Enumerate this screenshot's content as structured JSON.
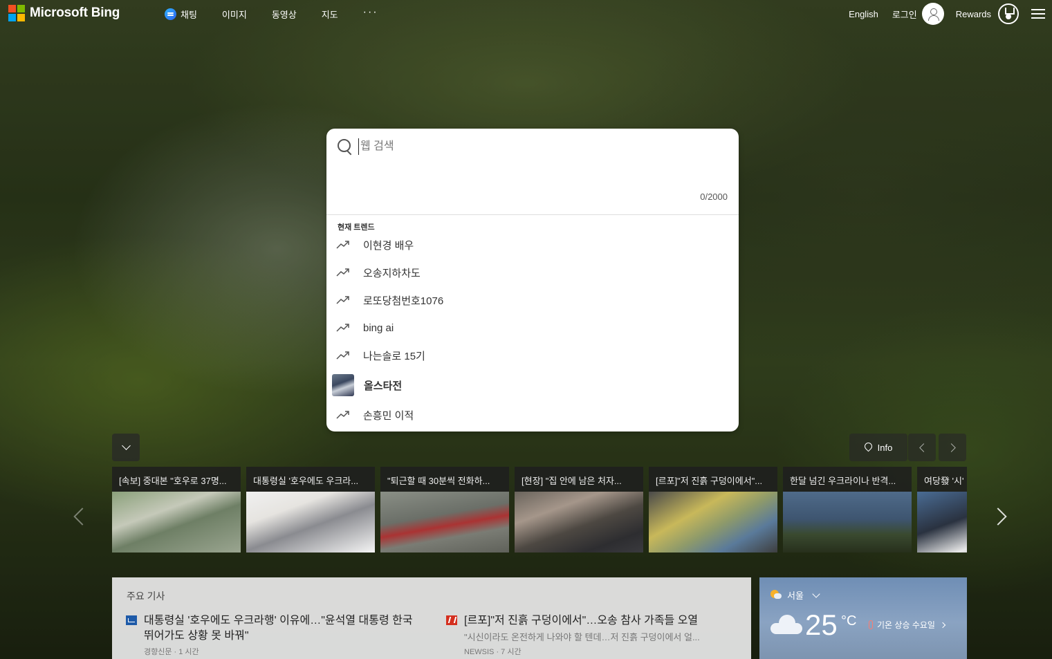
{
  "header": {
    "logo_text": "Microsoft Bing",
    "nav": [
      {
        "label": "채팅",
        "icon": "chat-icon"
      },
      {
        "label": "이미지"
      },
      {
        "label": "동영상"
      },
      {
        "label": "지도"
      },
      {
        "label": "···"
      }
    ],
    "language": "English",
    "login": "로그인",
    "rewards": "Rewards"
  },
  "search": {
    "placeholder": "웹 검색",
    "char_count": "0/2000",
    "trends_heading": "현재 트렌드",
    "trends": [
      "이현경 배우",
      "오송지하차도",
      "로또당첨번호1076",
      "bing ai",
      "나는솔로 15기",
      "올스타전",
      "손흥민 이적"
    ]
  },
  "carousel": {
    "info_label": "Info",
    "cards": [
      "[속보] 중대본 \"호우로 37명...",
      "대통령실 '호우에도 우크라...",
      "\"퇴근할 때 30분씩 전화하...",
      "[현장] \"집 안에 남은 처자...",
      "[르포]\"저 진흙 구덩이에서\"...",
      "한달 넘긴 우크라이나 반격...",
      "여당發 '시'"
    ]
  },
  "news": {
    "heading": "주요 기사",
    "items": [
      {
        "title": "대통령실 '호우에도 우크라행' 이유에…\"윤석열 대통령 한국 뛰어가도 상황 못 바꿔\"",
        "snippet": "",
        "source": "경향신문 · 1 시간"
      },
      {
        "title": "[르포]\"저 진흙 구덩이에서\"…오송 참사 가족들 오열",
        "snippet": "\"시신이라도 온전하게 나와야 할 텐데…저 진흙 구덩이에서 얼...",
        "source": "NEWSIS · 7 시간"
      }
    ]
  },
  "weather": {
    "location": "서울",
    "temperature": "25",
    "unit": "°C",
    "alert": "기온 상승 수요일"
  },
  "colors": {
    "ms_red": "#f25022",
    "ms_green": "#7fba00",
    "ms_blue": "#00a4ef",
    "ms_yellow": "#ffb900"
  }
}
